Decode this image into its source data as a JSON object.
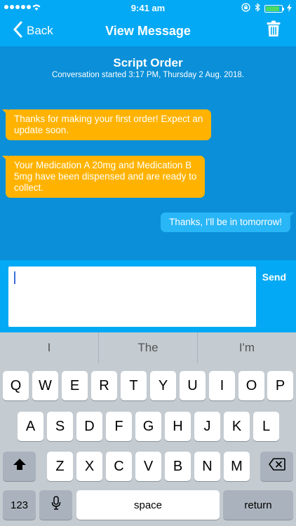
{
  "status": {
    "time": "9:41 am",
    "battery_level": 0.85,
    "battery_color": "#4cd964"
  },
  "nav": {
    "back_label": "Back",
    "title": "View Message"
  },
  "conversation": {
    "title": "Script Order",
    "subtitle": "Conversation started 3:17 PM, Thursday 2 Aug. 2018.",
    "messages": [
      {
        "from": "pharmacy",
        "text_lines": [
          "Thanks for making your first order! Expect an",
          "update soon."
        ]
      },
      {
        "from": "pharmacy",
        "text_lines": [
          "Your Medication A 20mg and Medication B",
          "5mg have been dispensed and are ready to",
          "collect."
        ]
      },
      {
        "from": "user",
        "text_lines": [
          "Thanks, I'll be in tomorrow!"
        ]
      }
    ]
  },
  "compose": {
    "input_value": "",
    "send_label": "Send"
  },
  "suggestions": [
    "I",
    "The",
    "I'm"
  ],
  "keyboard": {
    "row1": [
      "Q",
      "W",
      "E",
      "R",
      "T",
      "Y",
      "U",
      "I",
      "O",
      "P"
    ],
    "row2": [
      "A",
      "S",
      "D",
      "F",
      "G",
      "H",
      "J",
      "K",
      "L"
    ],
    "row3": [
      "Z",
      "X",
      "C",
      "V",
      "B",
      "N",
      "M"
    ],
    "numbers_label": "123",
    "space_label": "space",
    "return_label": "return"
  },
  "colors": {
    "nav_blue": "#03a9f4",
    "chat_blue": "#0a8fd8",
    "incoming_bubble": "#ffb300",
    "outgoing_bubble": "#29b6f6"
  }
}
